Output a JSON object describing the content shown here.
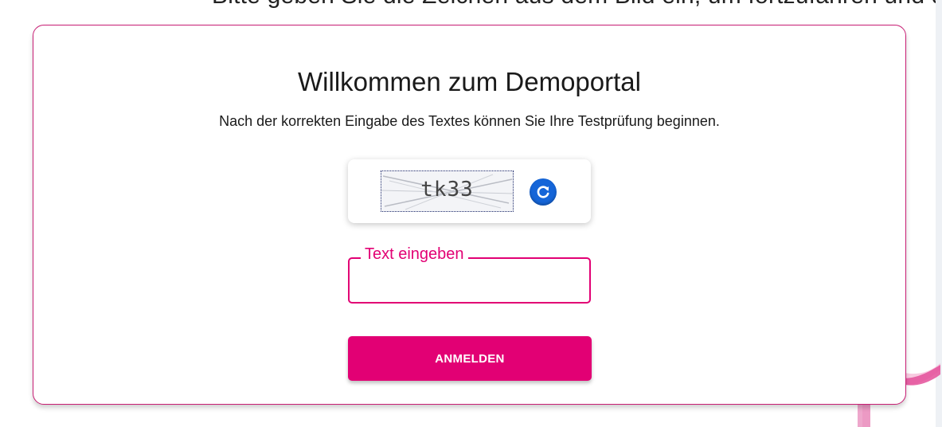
{
  "background": {
    "top_cut_text": "Bitte geben Sie die Zeichen aus dem Bild ein, um fortzufahren und die Prüfung zu starten"
  },
  "welcome": {
    "title": "Willkommen zum Demoportal",
    "subtitle": "Nach der korrekten Eingabe des Textes können Sie Ihre Testprüfung beginnen."
  },
  "captcha": {
    "text": "tk33",
    "refresh_icon": "refresh-icon"
  },
  "form": {
    "field_label": "Text eingeben",
    "field_value": "",
    "submit_label": "ANMELDEN"
  },
  "colors": {
    "brand_magenta": "#e20074",
    "card_border": "#c81e74",
    "refresh_blue": "#1565d8"
  }
}
